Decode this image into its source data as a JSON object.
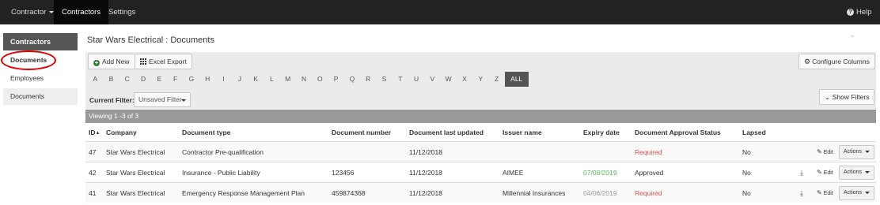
{
  "nav": {
    "contractor_menu": "Contractor",
    "contractors": "Contractors",
    "settings": "Settings",
    "help": "Help",
    "help_icon": "question-circle-icon"
  },
  "sidebar": {
    "header": "Contractors",
    "items": [
      {
        "label": "Documents"
      },
      {
        "label": "Employees"
      },
      {
        "label": "Documents"
      }
    ]
  },
  "page": {
    "title": "Star Wars Electrical : Documents"
  },
  "toolbar": {
    "add_new": "Add New",
    "excel_export": "Excel Export",
    "configure_columns": "Configure Columns",
    "show_filters": "Show Filters",
    "letters": [
      "A",
      "B",
      "C",
      "D",
      "E",
      "F",
      "G",
      "H",
      "I",
      "J",
      "K",
      "L",
      "M",
      "N",
      "O",
      "P",
      "Q",
      "R",
      "S",
      "T",
      "U",
      "V",
      "W",
      "X",
      "Y",
      "Z"
    ],
    "all_label": "ALL",
    "current_filter_label": "Current Filter:",
    "current_filter_value": "Unsaved Filter"
  },
  "table": {
    "viewing": "Viewing 1 -3 of 3",
    "headers": {
      "id": "ID",
      "company": "Company",
      "doc_type": "Document type",
      "doc_number": "Document number",
      "last_updated": "Document last updated",
      "issuer": "Issuer name",
      "expiry": "Expiry date",
      "approval": "Document Approval Status",
      "lapsed": "Lapsed"
    },
    "edit_label": "Edit",
    "actions_label": "Actions",
    "rows": [
      {
        "id": "47",
        "company": "Star Wars Electrical",
        "doc_type": "Contractor Pre-qualification",
        "doc_number": "",
        "last_updated": "11/12/2018",
        "issuer": "",
        "expiry": "",
        "approval": "Required",
        "lapsed": "No"
      },
      {
        "id": "42",
        "company": "Star Wars Electrical",
        "doc_type": "Insurance - Public Liability",
        "doc_number": "123456",
        "last_updated": "11/12/2018",
        "issuer": "AIMEE",
        "expiry": "07/08/2019",
        "approval": "Approved",
        "lapsed": "No"
      },
      {
        "id": "41",
        "company": "Star Wars Electrical",
        "doc_type": "Emergency Response Management Plan",
        "doc_number": "459874368",
        "last_updated": "11/12/2018",
        "issuer": "Millennial Insurances",
        "expiry": "04/06/2019",
        "approval": "Required",
        "lapsed": "No"
      }
    ]
  },
  "colors": {
    "navbar": "#222222",
    "required": "#d9534f",
    "valid_expiry": "#5cb85c",
    "past_expiry": "#999999",
    "annotation_circle": "#e00000"
  }
}
